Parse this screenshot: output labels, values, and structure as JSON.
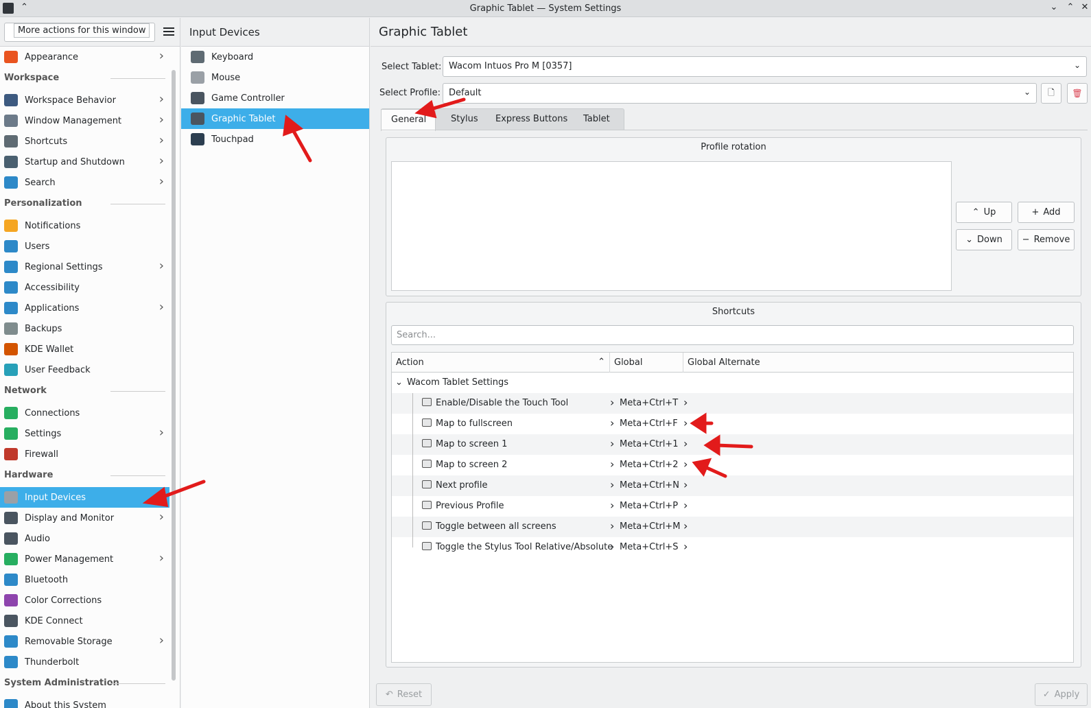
{
  "window": {
    "title": "Graphic Tablet — System Settings",
    "tooltip": "More actions for this window"
  },
  "sidebar": {
    "items": [
      {
        "label": "Appearance",
        "icon": "appearance-icon",
        "color": "#e95420",
        "chev": true
      },
      {
        "section": "Workspace"
      },
      {
        "label": "Workspace Behavior",
        "icon": "workspace-behavior-icon",
        "color": "#3d5a80",
        "chev": true
      },
      {
        "label": "Window Management",
        "icon": "window-management-icon",
        "color": "#6c7a89",
        "chev": true
      },
      {
        "label": "Shortcuts",
        "icon": "keyboard-icon",
        "color": "#5f6b73",
        "chev": true
      },
      {
        "label": "Startup and Shutdown",
        "icon": "startup-icon",
        "color": "#4a6070",
        "chev": true
      },
      {
        "label": "Search",
        "icon": "search-icon",
        "color": "#2d89c8",
        "chev": true
      },
      {
        "section": "Personalization"
      },
      {
        "label": "Notifications",
        "icon": "bell-icon",
        "color": "#f5a623",
        "chev": false
      },
      {
        "label": "Users",
        "icon": "users-icon",
        "color": "#2d89c8",
        "chev": false
      },
      {
        "label": "Regional Settings",
        "icon": "regional-settings-icon",
        "color": "#2d89c8",
        "chev": true
      },
      {
        "label": "Accessibility",
        "icon": "accessibility-icon",
        "color": "#2d89c8",
        "chev": false
      },
      {
        "label": "Applications",
        "icon": "applications-icon",
        "color": "#2d89c8",
        "chev": true
      },
      {
        "label": "Backups",
        "icon": "backups-icon",
        "color": "#7f8c8d",
        "chev": false
      },
      {
        "label": "KDE Wallet",
        "icon": "wallet-icon",
        "color": "#d35400",
        "chev": false
      },
      {
        "label": "User Feedback",
        "icon": "feedback-icon",
        "color": "#27a0b8",
        "chev": false
      },
      {
        "section": "Network"
      },
      {
        "label": "Connections",
        "icon": "globe-icon",
        "color": "#27ae60",
        "chev": false
      },
      {
        "label": "Settings",
        "icon": "network-settings-icon",
        "color": "#27ae60",
        "chev": true
      },
      {
        "label": "Firewall",
        "icon": "firewall-icon",
        "color": "#c0392b",
        "chev": false
      },
      {
        "section": "Hardware"
      },
      {
        "label": "Input Devices",
        "icon": "mouse-icon",
        "color": "#9aa0a6",
        "chev": false,
        "selected": true
      },
      {
        "label": "Display and Monitor",
        "icon": "monitor-icon",
        "color": "#4a5560",
        "chev": true
      },
      {
        "label": "Audio",
        "icon": "audio-icon",
        "color": "#4a5560",
        "chev": false
      },
      {
        "label": "Power Management",
        "icon": "power-icon",
        "color": "#27ae60",
        "chev": true
      },
      {
        "label": "Bluetooth",
        "icon": "bluetooth-icon",
        "color": "#2d89c8",
        "chev": false
      },
      {
        "label": "Color Corrections",
        "icon": "color-corrections-icon",
        "color": "#8e44ad",
        "chev": false
      },
      {
        "label": "KDE Connect",
        "icon": "kde-connect-icon",
        "color": "#4a5560",
        "chev": false
      },
      {
        "label": "Removable Storage",
        "icon": "removable-storage-icon",
        "color": "#2d89c8",
        "chev": true
      },
      {
        "label": "Thunderbolt",
        "icon": "thunderbolt-icon",
        "color": "#2d89c8",
        "chev": false
      },
      {
        "section": "System Administration"
      },
      {
        "label": "About this System",
        "icon": "info-icon",
        "color": "#2d89c8",
        "chev": false
      }
    ]
  },
  "middle": {
    "title": "Input Devices",
    "items": [
      {
        "label": "Keyboard",
        "icon": "keyboard-icon",
        "color": "#5f6b73"
      },
      {
        "label": "Mouse",
        "icon": "mouse-icon",
        "color": "#9aa0a6"
      },
      {
        "label": "Game Controller",
        "icon": "gamepad-icon",
        "color": "#4a5560"
      },
      {
        "label": "Graphic Tablet",
        "icon": "tablet-icon",
        "color": "#4a5560",
        "selected": true
      },
      {
        "label": "Touchpad",
        "icon": "touchpad-icon",
        "color": "#2c3e50"
      }
    ]
  },
  "main": {
    "title": "Graphic Tablet",
    "select_tablet_label": "Select Tablet:",
    "select_tablet_value": "Wacom Intuos Pro M [0357]",
    "select_profile_label": "Select Profile:",
    "select_profile_value": "Default",
    "tabs": [
      "General",
      "Stylus",
      "Express Buttons",
      "Tablet"
    ],
    "profile_rotation": {
      "title": "Profile rotation",
      "up": "Up",
      "add": "Add",
      "down": "Down",
      "remove": "Remove"
    },
    "shortcuts": {
      "title": "Shortcuts",
      "search_placeholder": "Search...",
      "columns": [
        "Action",
        "Global",
        "Global Alternate"
      ],
      "group": "Wacom Tablet Settings",
      "rows": [
        {
          "action": "Enable/Disable the Touch Tool",
          "global": "Meta+Ctrl+T"
        },
        {
          "action": "Map to fullscreen",
          "global": "Meta+Ctrl+F"
        },
        {
          "action": "Map to screen 1",
          "global": "Meta+Ctrl+1"
        },
        {
          "action": "Map to screen 2",
          "global": "Meta+Ctrl+2"
        },
        {
          "action": "Next profile",
          "global": "Meta+Ctrl+N"
        },
        {
          "action": "Previous Profile",
          "global": "Meta+Ctrl+P"
        },
        {
          "action": "Toggle between all screens",
          "global": "Meta+Ctrl+M"
        },
        {
          "action": "Toggle the Stylus Tool Relative/Absolute",
          "global": "Meta+Ctrl+S"
        }
      ]
    },
    "footer": {
      "reset": "Reset",
      "apply": "Apply"
    }
  }
}
